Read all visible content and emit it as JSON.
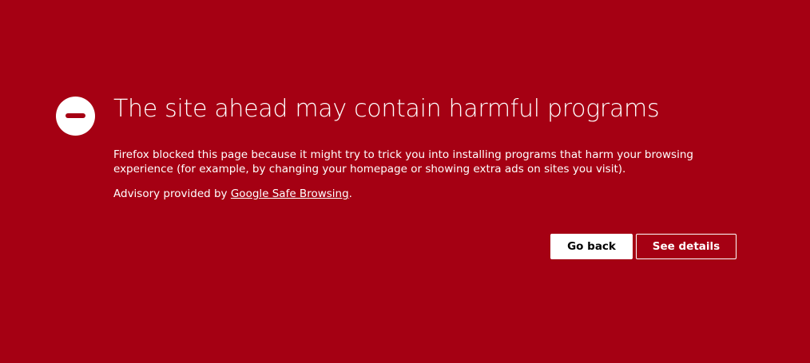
{
  "colors": {
    "background": "#a50013",
    "text": "#ffffff",
    "primary_button_bg": "#ffffff",
    "primary_button_text": "#000000"
  },
  "icon": {
    "name": "blocked-icon"
  },
  "error": {
    "title": "The site ahead may contain harmful programs",
    "description": "Firefox blocked this page because it might try to trick you into installing programs that harm your browsing experience (for example, by changing your homepage or showing extra ads on sites you visit).",
    "advisory_prefix": "Advisory provided by ",
    "advisory_link": "Google Safe Browsing",
    "advisory_suffix": "."
  },
  "buttons": {
    "go_back": "Go back",
    "see_details": "See details"
  }
}
